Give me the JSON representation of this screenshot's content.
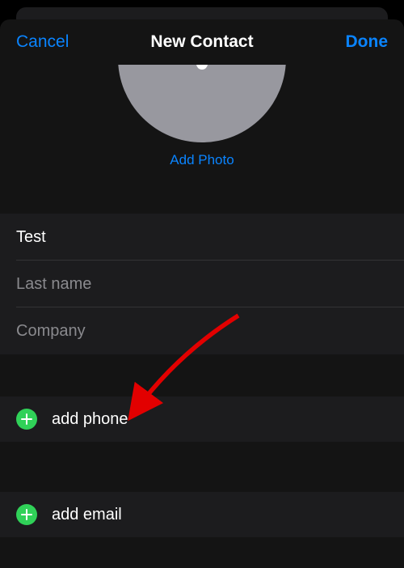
{
  "nav": {
    "cancel": "Cancel",
    "title": "New Contact",
    "done": "Done"
  },
  "photo": {
    "add_label": "Add Photo"
  },
  "fields": {
    "first_name_value": "Test",
    "last_name_placeholder": "Last name",
    "company_placeholder": "Company"
  },
  "actions": {
    "add_phone": "add phone",
    "add_email": "add email"
  }
}
